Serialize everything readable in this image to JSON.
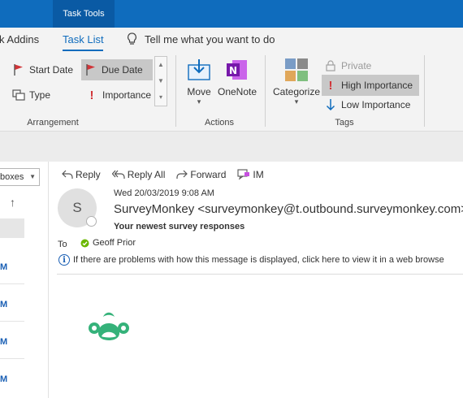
{
  "title_bar": {
    "context_tab": "Task Tools"
  },
  "tabs": {
    "addins": "k Addins",
    "task_list": "Task List",
    "tell_me": "Tell me what you want to do"
  },
  "ribbon": {
    "arrangement": {
      "label": "Arrangement",
      "items": [
        "Start Date",
        "Due Date",
        "Type",
        "Importance"
      ]
    },
    "actions": {
      "label": "Actions",
      "move": "Move",
      "onenote": "OneNote"
    },
    "tags": {
      "label": "Tags",
      "categorize": "Categorize",
      "private": "Private",
      "high": "High Importance",
      "low": "Low Importance"
    }
  },
  "left_pane": {
    "folder_select": "boxes",
    "marks": [
      "M",
      "M",
      "M",
      "M"
    ]
  },
  "message": {
    "actions": {
      "reply": "Reply",
      "reply_all": "Reply All",
      "forward": "Forward",
      "im": "IM"
    },
    "avatar_initial": "S",
    "date": "Wed 20/03/2019 9:08 AM",
    "sender": "SurveyMonkey <surveymonkey@t.outbound.surveymonkey.com>",
    "subject": "Your newest survey responses",
    "to_label": "To",
    "recipient": "Geoff Prior",
    "info": "If there are problems with how this message is displayed, click here to view it in a web browse"
  },
  "colors": {
    "brand_blue": "#0f6cbd",
    "logo_green": "#35b27a",
    "flag_red": "#d13438"
  }
}
